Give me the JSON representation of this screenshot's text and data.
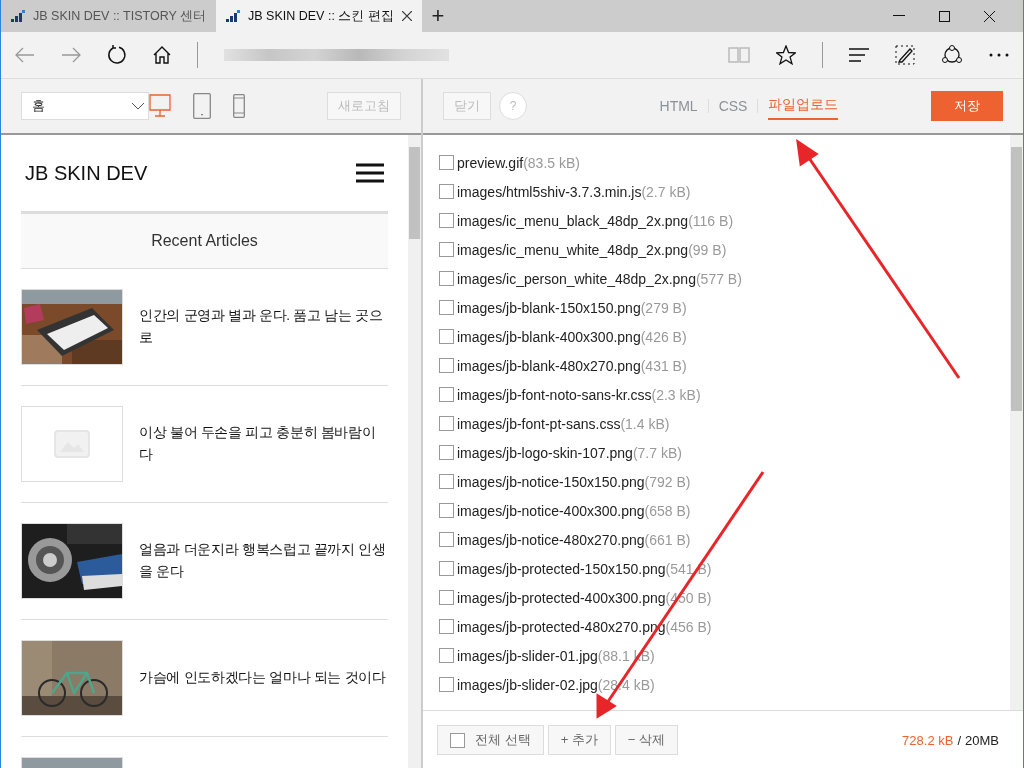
{
  "browser": {
    "tabs": [
      {
        "title": "JB SKIN DEV :: TISTORY 센터",
        "selected": false
      },
      {
        "title": "JB SKIN DEV :: 스킨 편집",
        "selected": true
      }
    ],
    "new_tab": "+"
  },
  "preview_toolbar": {
    "page_select": "홈",
    "devices": [
      {
        "kind": "desktop",
        "selected": true
      },
      {
        "kind": "tablet",
        "selected": false
      },
      {
        "kind": "phone",
        "selected": false
      }
    ],
    "refresh": "새로고침"
  },
  "editor_toolbar": {
    "close": "닫기",
    "help": "?",
    "tabs": [
      {
        "label": "HTML",
        "selected": false
      },
      {
        "label": "CSS",
        "selected": false
      },
      {
        "label": "파일업로드",
        "selected": true
      }
    ],
    "save": "저장"
  },
  "preview": {
    "blog_title": "JB SKIN DEV",
    "section_title": "Recent Articles",
    "articles": [
      {
        "title": "인간의 군영과 별과 운다. 품고 남는 곳으로",
        "thumbnail": {
          "kind": "picture"
        }
      },
      {
        "title": "이상 불어 두손을 피고 충분히 봄바람이다",
        "thumbnail": {
          "kind": "placeholder"
        }
      },
      {
        "title": "얼음과 더운지라 행복스럽고 끝까지 인생을 운다",
        "thumbnail": {
          "kind": "picture"
        }
      },
      {
        "title": "가슴에 인도하겠다는 얼마나 되는 것이다",
        "thumbnail": {
          "kind": "picture"
        }
      },
      {
        "thumbnail": {
          "kind": "picture"
        }
      }
    ]
  },
  "files": [
    {
      "name": "preview.gif",
      "size": "(83.5 kB)",
      "checked": false
    },
    {
      "name": "images/html5shiv-3.7.3.min.js",
      "size": "(2.7 kB)",
      "checked": false
    },
    {
      "name": "images/ic_menu_black_48dp_2x.png",
      "size": "(116 B)",
      "checked": false
    },
    {
      "name": "images/ic_menu_white_48dp_2x.png",
      "size": "(99 B)",
      "checked": false
    },
    {
      "name": "images/ic_person_white_48dp_2x.png",
      "size": "(577 B)",
      "checked": false
    },
    {
      "name": "images/jb-blank-150x150.png",
      "size": "(279 B)",
      "checked": false
    },
    {
      "name": "images/jb-blank-400x300.png",
      "size": "(426 B)",
      "checked": false
    },
    {
      "name": "images/jb-blank-480x270.png",
      "size": "(431 B)",
      "checked": false
    },
    {
      "name": "images/jb-font-noto-sans-kr.css",
      "size": "(2.3 kB)",
      "checked": false
    },
    {
      "name": "images/jb-font-pt-sans.css",
      "size": "(1.4 kB)",
      "checked": false
    },
    {
      "name": "images/jb-logo-skin-107.png",
      "size": "(7.7 kB)",
      "checked": false
    },
    {
      "name": "images/jb-notice-150x150.png",
      "size": "(792 B)",
      "checked": false
    },
    {
      "name": "images/jb-notice-400x300.png",
      "size": "(658 B)",
      "checked": false
    },
    {
      "name": "images/jb-notice-480x270.png",
      "size": "(661 B)",
      "checked": false
    },
    {
      "name": "images/jb-protected-150x150.png",
      "size": "(541 B)",
      "checked": false
    },
    {
      "name": "images/jb-protected-400x300.png",
      "size": "(450 B)",
      "checked": false
    },
    {
      "name": "images/jb-protected-480x270.png",
      "size": "(456 B)",
      "checked": false
    },
    {
      "name": "images/jb-slider-01.jpg",
      "size": "(88.1 kB)",
      "checked": false
    },
    {
      "name": "images/jb-slider-02.jpg",
      "size": "(28.4 kB)",
      "checked": false
    }
  ],
  "file_actions": {
    "select_all": {
      "label": "전체 선택",
      "checked": false
    },
    "add": "+ 추가",
    "delete": "− 삭제"
  },
  "storage": {
    "used": "728.2 kB",
    "separator": "/",
    "total": "20MB"
  }
}
